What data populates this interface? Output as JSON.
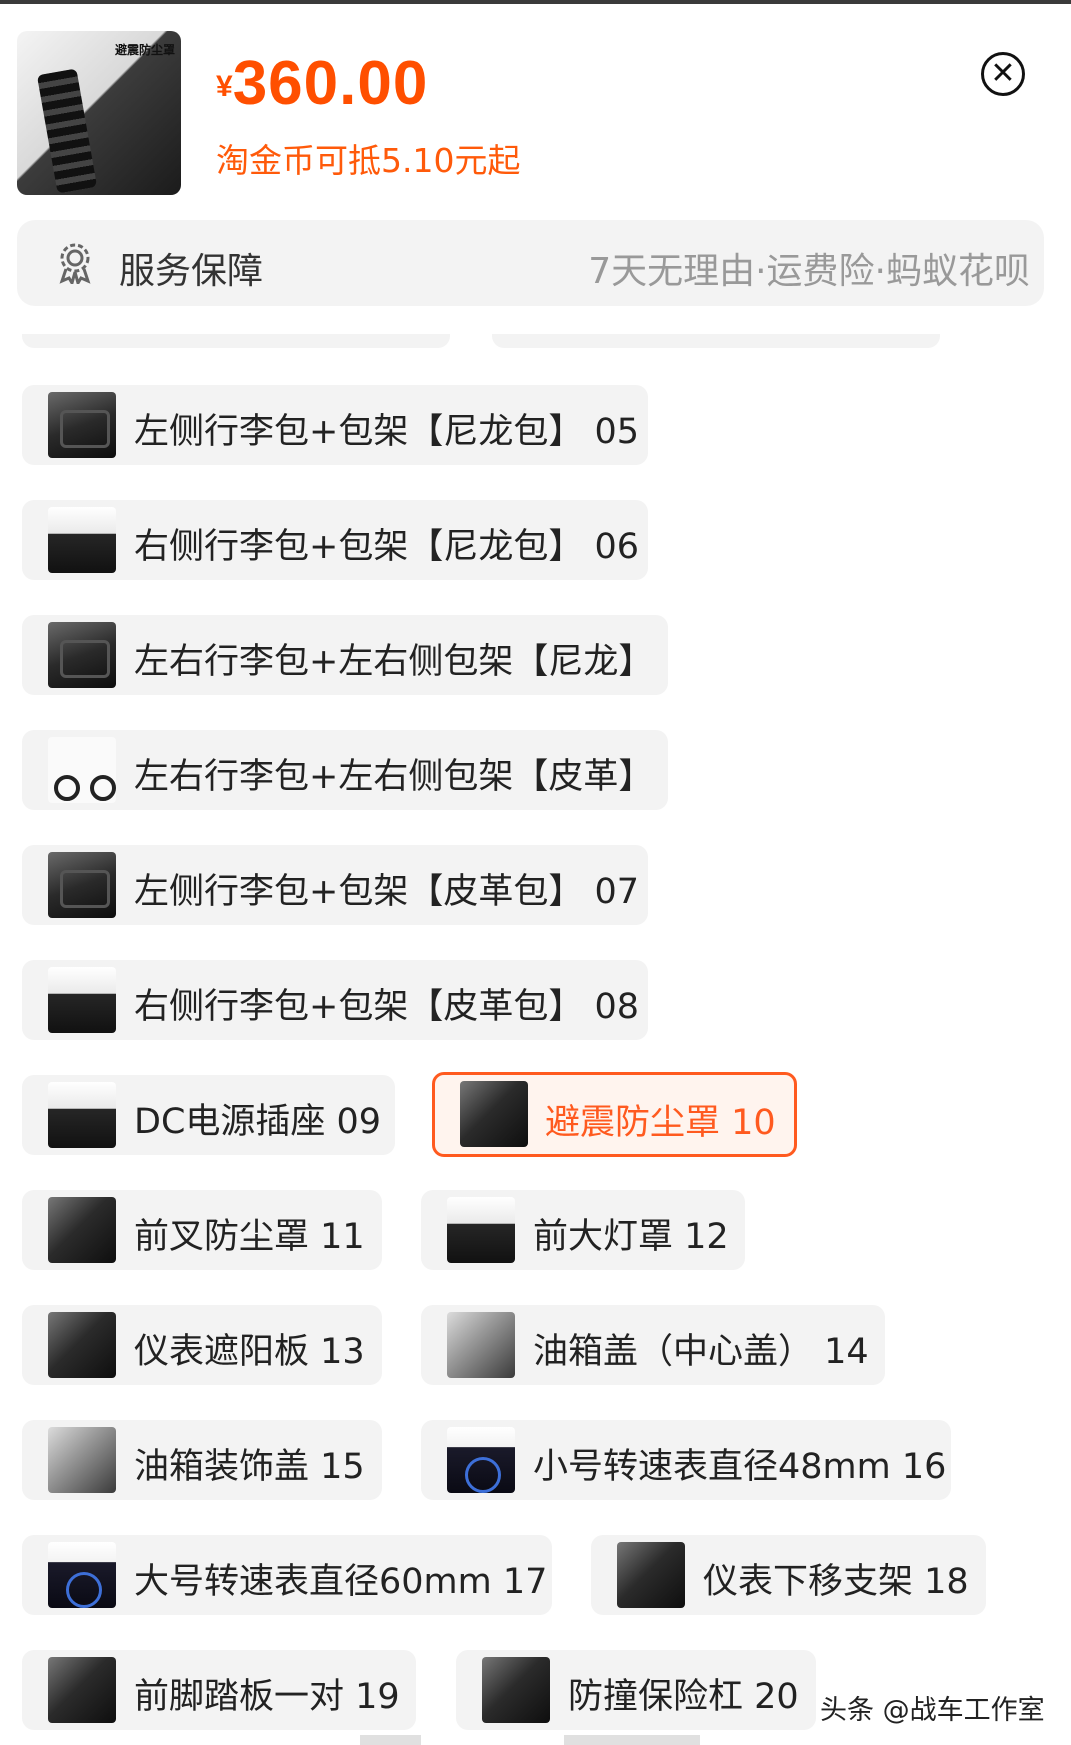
{
  "header": {
    "thumbnail_caption": "避震防尘罩",
    "currency": "¥",
    "price": "360.00",
    "coin_offer": "淘金币可抵5.10元起",
    "close_icon": "close-circle-icon"
  },
  "service": {
    "icon": "badge-icon",
    "label": "服务保障",
    "guarantee": "7天无理由·运费险·蚂蚁花呗"
  },
  "options": [
    {
      "label": "左侧行李包+包架【尼龙包】 05",
      "selected": false
    },
    {
      "label": "右侧行李包+包架【尼龙包】 06",
      "selected": false
    },
    {
      "label": "左右行李包+左右侧包架【尼龙】",
      "selected": false
    },
    {
      "label": "左右行李包+左右侧包架【皮革】",
      "selected": false
    },
    {
      "label": "左侧行李包+包架【皮革包】 07",
      "selected": false
    },
    {
      "label": "右侧行李包+包架【皮革包】 08",
      "selected": false
    },
    {
      "label": "DC电源插座 09",
      "selected": false
    },
    {
      "label": "避震防尘罩 10",
      "selected": true
    },
    {
      "label": "前叉防尘罩 11",
      "selected": false
    },
    {
      "label": "前大灯罩 12",
      "selected": false
    },
    {
      "label": "仪表遮阳板 13",
      "selected": false
    },
    {
      "label": "油箱盖（中心盖） 14",
      "selected": false
    },
    {
      "label": "油箱装饰盖 15",
      "selected": false
    },
    {
      "label": "小号转速表直径48mm 16",
      "selected": false
    },
    {
      "label": "大号转速表直径60mm 17",
      "selected": false
    },
    {
      "label": "仪表下移支架 18",
      "selected": false
    },
    {
      "label": "前脚踏板一对 19",
      "selected": false
    },
    {
      "label": "防撞保险杠 20",
      "selected": false
    }
  ],
  "watermark": "头条 @战车工作室",
  "colors": {
    "accent": "#ff4f00",
    "option_bg": "#f3f3f3",
    "selected_border": "#ff5a1f"
  }
}
